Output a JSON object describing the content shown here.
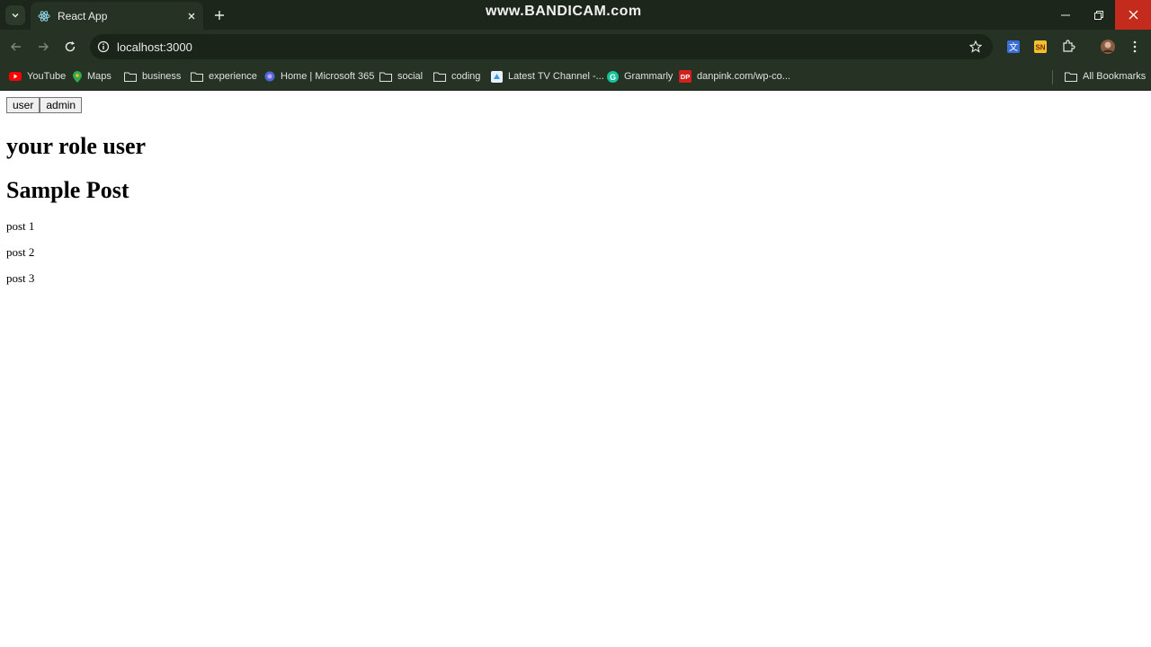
{
  "browser": {
    "tab_title": "React App",
    "watermark": "www.BANDICAM.com",
    "url": "localhost:3000",
    "bookmarks": [
      {
        "label": "YouTube",
        "icon": "youtube-icon"
      },
      {
        "label": "Maps",
        "icon": "maps-icon"
      },
      {
        "label": "business",
        "icon": "folder-icon"
      },
      {
        "label": "experience",
        "icon": "folder-icon"
      },
      {
        "label": "Home | Microsoft 365",
        "icon": "microsoft365-icon"
      },
      {
        "label": "social",
        "icon": "folder-icon"
      },
      {
        "label": "coding",
        "icon": "folder-icon"
      },
      {
        "label": "Latest TV Channel -...",
        "icon": "tv-channel-icon"
      },
      {
        "label": "Grammarly",
        "icon": "grammarly-icon"
      },
      {
        "label": "danpink.com/wp-co...",
        "icon": "dp-icon"
      }
    ],
    "all_bookmarks": "All Bookmarks",
    "colors": {
      "frame": "#1c261b",
      "toolbar": "#263324",
      "close": "#c42b1c"
    }
  },
  "page": {
    "buttons": {
      "user": "user",
      "admin": "admin"
    },
    "role_heading": "your role user",
    "posts_heading": "Sample Post",
    "posts": [
      "post 1",
      "post 2",
      "post 3"
    ]
  }
}
